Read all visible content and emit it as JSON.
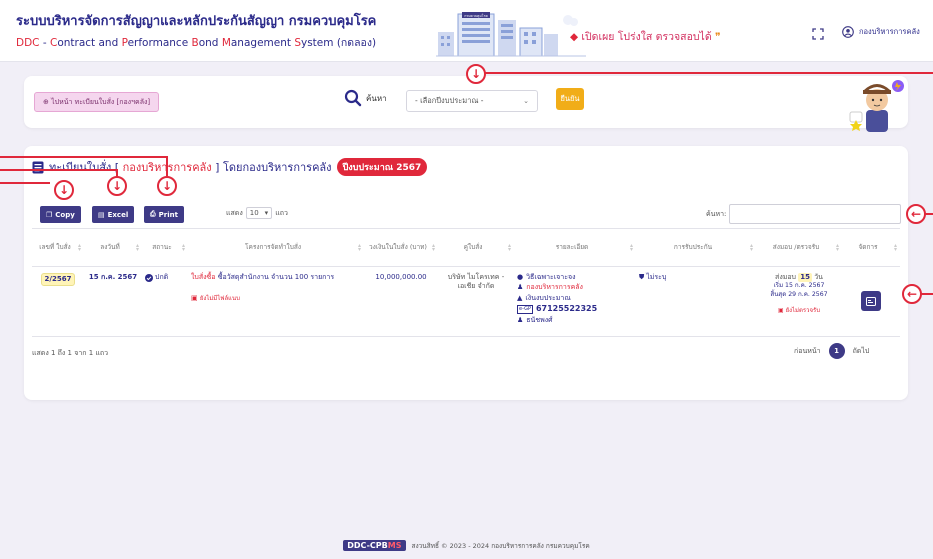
{
  "header": {
    "title_th": "ระบบบริหารจัดการสัญญาและหลักประกันสัญญา กรมควบคุมโรค",
    "title_en_parts": [
      {
        "text": "DDC",
        "hl": true
      },
      {
        "text": " - ",
        "hl": false
      },
      {
        "text": "C",
        "hl": true
      },
      {
        "text": "ontract and ",
        "hl": false
      },
      {
        "text": "P",
        "hl": true
      },
      {
        "text": "erformance ",
        "hl": false
      },
      {
        "text": "B",
        "hl": true
      },
      {
        "text": "ond ",
        "hl": false
      },
      {
        "text": "M",
        "hl": true
      },
      {
        "text": "anagement ",
        "hl": false
      },
      {
        "text": "S",
        "hl": true
      },
      {
        "text": "ystem (กดลอง)",
        "hl": false
      }
    ],
    "building_sign": "กรมควบคุมโรค",
    "slogan_main": "เปิดเผย โปร่งใส ตรวจสอบได้",
    "slogan_quote": "❞",
    "user_name": "กองบริหารการคลัง"
  },
  "filter": {
    "back_label": "ไปหน้า ทะเบียนใบสั่ง [กองฯคลัง]",
    "search_label": "ค้นหา",
    "year_placeholder": "- เลือกปีงบประมาณ -",
    "choose_label": "ยืนยัน"
  },
  "card": {
    "title_prefix": "ทะเบียนใบสั่ง [ ",
    "title_dept": "กองบริหารการคลัง",
    "title_suffix": " ] โดยกองบริหารการคลัง",
    "year_badge": "ปีงบประมาณ 2567"
  },
  "toolbar": {
    "copy_label": "Copy",
    "excel_label": "Excel",
    "print_label": "Print",
    "length_prefix": "แสดง",
    "length_value": "10",
    "length_suffix": "แถว",
    "search_label": "ค้นหา:"
  },
  "table": {
    "headers": [
      "เลขที่ ใบสั่ง",
      "ลงวันที่",
      "สถานะ",
      "โครงการจัดทำใบสั่ง",
      "วงเงินในใบสั่ง (บาท)",
      "คู่ใบสั่ง",
      "รายละเอียด",
      "การรับประกัน",
      "ส่งมอบ /ตรวจรับ",
      "จัดการ"
    ],
    "row": {
      "doc_no": "2/2567",
      "date": "15 ก.ค. 2567",
      "status": "ปกติ",
      "project_type": "ใบสั่งซื้อ",
      "project_name": "ซื้อวัสดุสำนักงาน จำนวน 100 รายการ",
      "project_note": "ยังไม่มีไฟล์แนบ",
      "amount": "10,000,000.00",
      "vendor": "บริษัท ไมโครเทค - เอเชีย จำกัด",
      "detail_method": "วิธีเฉพาะเจาะจง",
      "detail_dept": "กองบริหารการคลัง",
      "detail_budget": "เงินงบประมาณ",
      "detail_egp": "67125522325",
      "detail_person": "ธนัชพงศ์",
      "warranty": "ไม่ระบุ",
      "delivery_prefix": "ส่งมอบ",
      "delivery_days": "15",
      "delivery_unit": "วัน",
      "delivery_start": "เริ่ม 15 ก.ค. 2567",
      "delivery_end": "สิ้นสุด 29 ก.ค. 2567",
      "delivery_note": "ยังไม่ตรวจรับ"
    }
  },
  "footer_table": {
    "info": "แสดง 1 ถึง 1 จาก 1 แถว",
    "prev": "ก่อนหน้า",
    "page": "1",
    "next": "ถัดไป"
  },
  "footer": {
    "logo_main": "DDC-CPB",
    "logo_accent": "MS",
    "copyright": "สงวนสิทธิ์ © 2023 - 2024 กองบริหารการคลัง กรมควบคุมโรค"
  },
  "colors": {
    "primary": "#3e3a86",
    "accent_red": "#e0283b",
    "warning": "#f1ad18",
    "background": "#f1eff7"
  }
}
